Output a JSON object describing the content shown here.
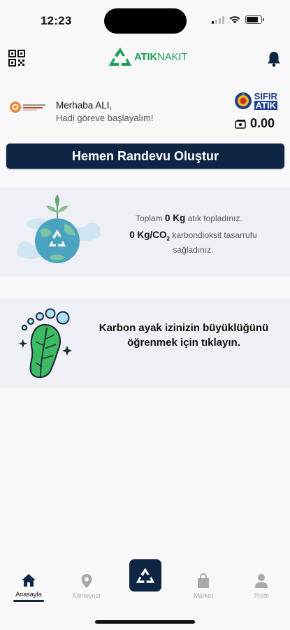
{
  "status_bar": {
    "time": "12:23",
    "battery_level": 0.85
  },
  "header": {
    "logo_bold": "ATIK",
    "logo_light": "NAKIT",
    "icons": [
      "qr-code-icon",
      "bell-icon"
    ]
  },
  "greeting": {
    "hello": "Merhaba ALI,",
    "sub": "Hadi göreve başlayalım!"
  },
  "badge": {
    "line1": "SIFIR",
    "line2": "ATIK"
  },
  "balance": {
    "value": "0.00"
  },
  "appointment": {
    "label": "Hemen Randevu Oluştur"
  },
  "stats": {
    "total_prefix": "Toplam ",
    "total_value": "0 Kg",
    "total_suffix": " atık topladınız.",
    "carbon_value": "0 Kg/CO",
    "carbon_sub": "2",
    "carbon_suffix": " karbondioksit tasarrufu sağladınız."
  },
  "footprint": {
    "text": "Karbon ayak izinizin büyüklüğünü öğrenmek için tıklayın."
  },
  "tabbar": {
    "tabs": [
      {
        "label": "Anasayfa",
        "icon": "home-icon",
        "active": true
      },
      {
        "label": "Konteyner",
        "icon": "location-pin-icon",
        "active": false
      },
      {
        "label": "Market",
        "icon": "shopping-bag-icon",
        "active": false
      },
      {
        "label": "Profil",
        "icon": "user-icon",
        "active": false
      }
    ],
    "center_icon": "recycle-icon"
  },
  "colors": {
    "primary": "#0e2544",
    "brand_green": "#1e9e57",
    "card_bg": "#eef0f5"
  }
}
